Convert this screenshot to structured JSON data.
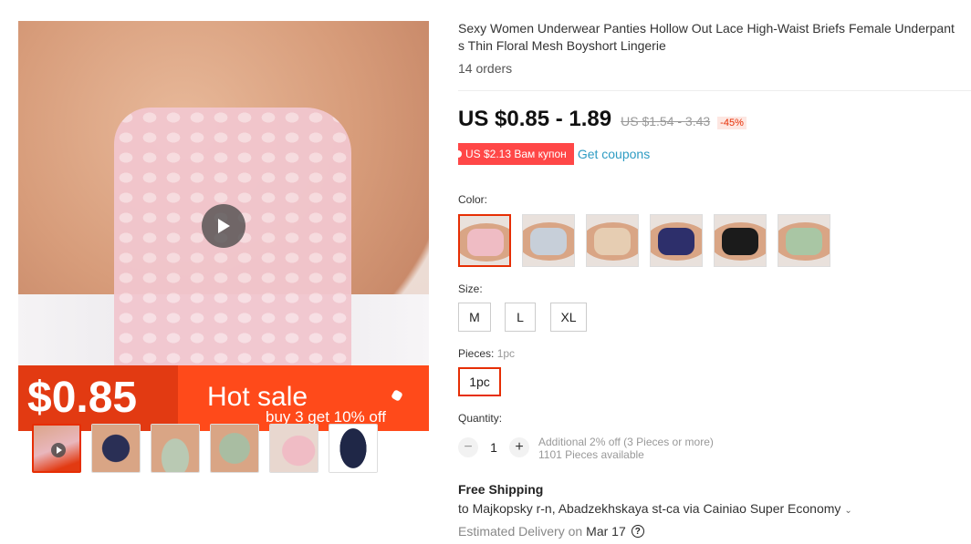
{
  "gallery": {
    "promo_price": "$0.85",
    "promo_title": "Hot sale",
    "promo_subtitle": "buy 3 get 10% off",
    "thumbnails": [
      {
        "name": "thumb-pink-video",
        "color": "#e9b7bd"
      },
      {
        "name": "thumb-navy",
        "color": "#2a2f55"
      },
      {
        "name": "thumb-sage",
        "color": "#b9c9b3"
      },
      {
        "name": "thumb-sage-2",
        "color": "#a9bda2"
      },
      {
        "name": "thumb-pink",
        "color": "#f0bcc5"
      },
      {
        "name": "thumb-navy-flat",
        "color": "#1f2747"
      }
    ]
  },
  "product": {
    "title": "Sexy Women Underwear Panties Hollow Out Lace High-Waist Briefs Female Underpants Thin Floral Mesh Boyshort Lingerie",
    "orders": "14 orders",
    "price": "US $0.85 - 1.89",
    "original_price": "US $1.54 - 3.43",
    "discount": "-45%",
    "coupon": "US $2.13 Вам купон",
    "get_coupons": "Get coupons"
  },
  "options": {
    "color_label": "Color:",
    "colors": [
      {
        "name": "pink",
        "hex": "#efbcc4"
      },
      {
        "name": "light-blue",
        "hex": "#c7cfd9"
      },
      {
        "name": "beige",
        "hex": "#e6cdb2"
      },
      {
        "name": "navy",
        "hex": "#2d2f6b"
      },
      {
        "name": "black",
        "hex": "#1b1b1b"
      },
      {
        "name": "green",
        "hex": "#a9c6a4"
      }
    ],
    "size_label": "Size:",
    "sizes": [
      "M",
      "L",
      "XL"
    ],
    "pieces_label": "Pieces:",
    "pieces_selected": "1pc",
    "pieces_option": "1pc",
    "quantity_label": "Quantity:",
    "quantity": "1",
    "quantity_discount": "Additional 2% off (3 Pieces or more)",
    "available": "1101 Pieces available"
  },
  "shipping": {
    "title": "Free Shipping",
    "destination": "to Majkopsky r-n, Abadzekhskaya st-ca via Cainiao Super Economy",
    "estimated_label": "Estimated Delivery on",
    "estimated_date": "Mar 17"
  },
  "colors": {
    "accent": "#e62e04",
    "coupon_bg": "#ff4747",
    "link": "#2e9cc3",
    "promo_bg": "#ff4a1a"
  }
}
